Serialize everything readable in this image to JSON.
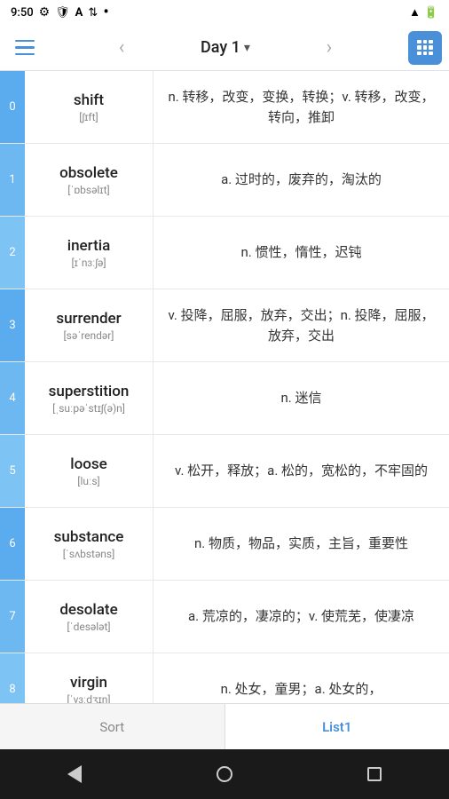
{
  "statusBar": {
    "time": "9:50",
    "icons": [
      "settings",
      "shield",
      "a",
      "wifi",
      "dot",
      "signal",
      "battery"
    ]
  },
  "topNav": {
    "menuLabel": "Menu",
    "prevLabel": "Previous",
    "title": "Day 1",
    "titleChevron": "▾",
    "nextLabel": "Next",
    "listViewLabel": "List View"
  },
  "words": [
    {
      "index": "0",
      "english": "shift",
      "phonetic": "[ʃɪft]",
      "meaning": "n. 转移，改变，变换，转换；v. 转移，改变，转向，推卸"
    },
    {
      "index": "1",
      "english": "obsolete",
      "phonetic": "[ˈɒbsəlɪt]",
      "meaning": "a. 过时的，废弃的，淘汰的"
    },
    {
      "index": "2",
      "english": "inertia",
      "phonetic": "[ɪˈnɜːʃə]",
      "meaning": "n. 惯性，惰性，迟钝"
    },
    {
      "index": "3",
      "english": "surrender",
      "phonetic": "[səˈrendər]",
      "meaning": "v. 投降，屈服，放弃，交出；n. 投降，屈服，放弃，交出"
    },
    {
      "index": "4",
      "english": "superstition",
      "phonetic": "[ˌsuːpəˈstɪʃ(ə)n]",
      "meaning": "n. 迷信"
    },
    {
      "index": "5",
      "english": "loose",
      "phonetic": "[luːs]",
      "meaning": "v. 松开，释放；a. 松的，宽松的，不牢固的"
    },
    {
      "index": "6",
      "english": "substance",
      "phonetic": "[ˈsʌbstəns]",
      "meaning": "n. 物质，物品，实质，主旨，重要性"
    },
    {
      "index": "7",
      "english": "desolate",
      "phonetic": "[ˈdesələt]",
      "meaning": "a. 荒凉的，凄凉的；v. 使荒芜，使凄凉"
    },
    {
      "index": "8",
      "english": "virgin",
      "phonetic": "[ˈvɜːdʒɪn]",
      "meaning": "n. 处女，童男；a. 处女的，"
    }
  ],
  "bottomTabs": [
    {
      "label": "Sort",
      "active": false
    },
    {
      "label": "List1",
      "active": true
    }
  ],
  "androidNav": {
    "backLabel": "Back",
    "homeLabel": "Home",
    "recentsLabel": "Recents"
  }
}
